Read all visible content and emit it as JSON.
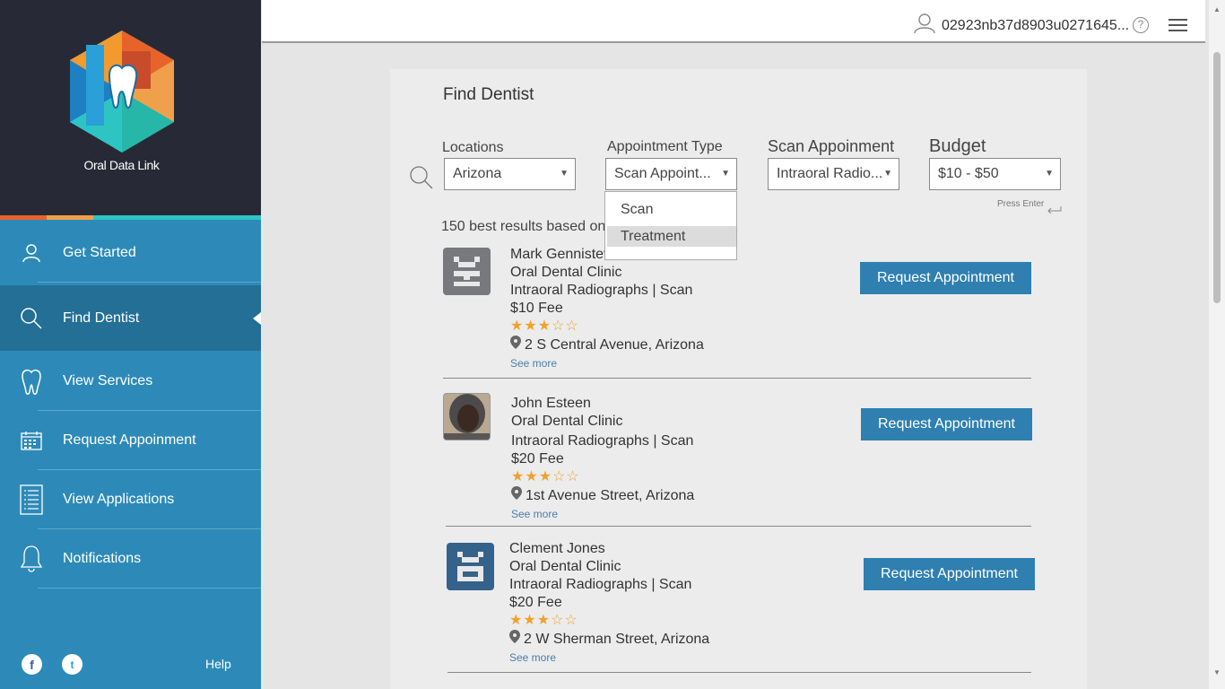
{
  "app": {
    "brand_name": "Oral Data Link"
  },
  "topbar": {
    "user_id": "02923nb37d8903u0271645..."
  },
  "sidebar": {
    "items": [
      {
        "label": "Get Started",
        "icon": "user-icon"
      },
      {
        "label": "Find Dentist",
        "icon": "search-icon",
        "active": true
      },
      {
        "label": "View Services",
        "icon": "tooth-icon"
      },
      {
        "label": "Request Appoinment",
        "icon": "calendar-icon"
      },
      {
        "label": "View Applications",
        "icon": "document-list-icon"
      },
      {
        "label": "Notifications",
        "icon": "bell-icon"
      }
    ],
    "help_label": "Help",
    "social": [
      "facebook-icon",
      "twitter-icon"
    ]
  },
  "main": {
    "title": "Find Dentist",
    "filters": {
      "locations_label": "Locations",
      "locations_value": "Arizona",
      "appointment_type_label": "Appointment Type",
      "appointment_type_value": "Scan Appoint...",
      "scan_label": "Scan Appoinment",
      "scan_value": "Intraoral Radio...",
      "budget_label": "Budget",
      "budget_value": "$10 - $50",
      "press_enter": "Press Enter"
    },
    "dropdown_options": [
      "Scan",
      "Treatment"
    ],
    "results_count": "150 best results based on",
    "results": [
      {
        "name": "Mark Gennistev",
        "clinic": "Oral Dental Clinic",
        "service": "Intraoral Radiographs | Scan",
        "fee": "$10 Fee",
        "rating": 3,
        "address": "2 S Central Avenue, Arizona",
        "see_more": "See more",
        "button": "Request Appointment"
      },
      {
        "name": "John Esteen",
        "clinic": "Oral Dental Clinic",
        "service": "Intraoral Radiographs | Scan",
        "fee": "$20 Fee",
        "rating": 3,
        "address": "1st Avenue Street, Arizona",
        "see_more": "See more",
        "button": "Request Appointment"
      },
      {
        "name": "Clement Jones",
        "clinic": "Oral Dental Clinic",
        "service": "Intraoral Radiographs | Scan",
        "fee": "$20 Fee",
        "rating": 3,
        "address": "2 W Sherman Street, Arizona",
        "see_more": "See more",
        "button": "Request Appointment"
      }
    ]
  },
  "colors": {
    "sidebar": "#2d8ab8",
    "sidebar_active": "#236f96",
    "brand_bg": "#272a36",
    "button": "#2f7fb0",
    "star": "#f0a22c"
  }
}
